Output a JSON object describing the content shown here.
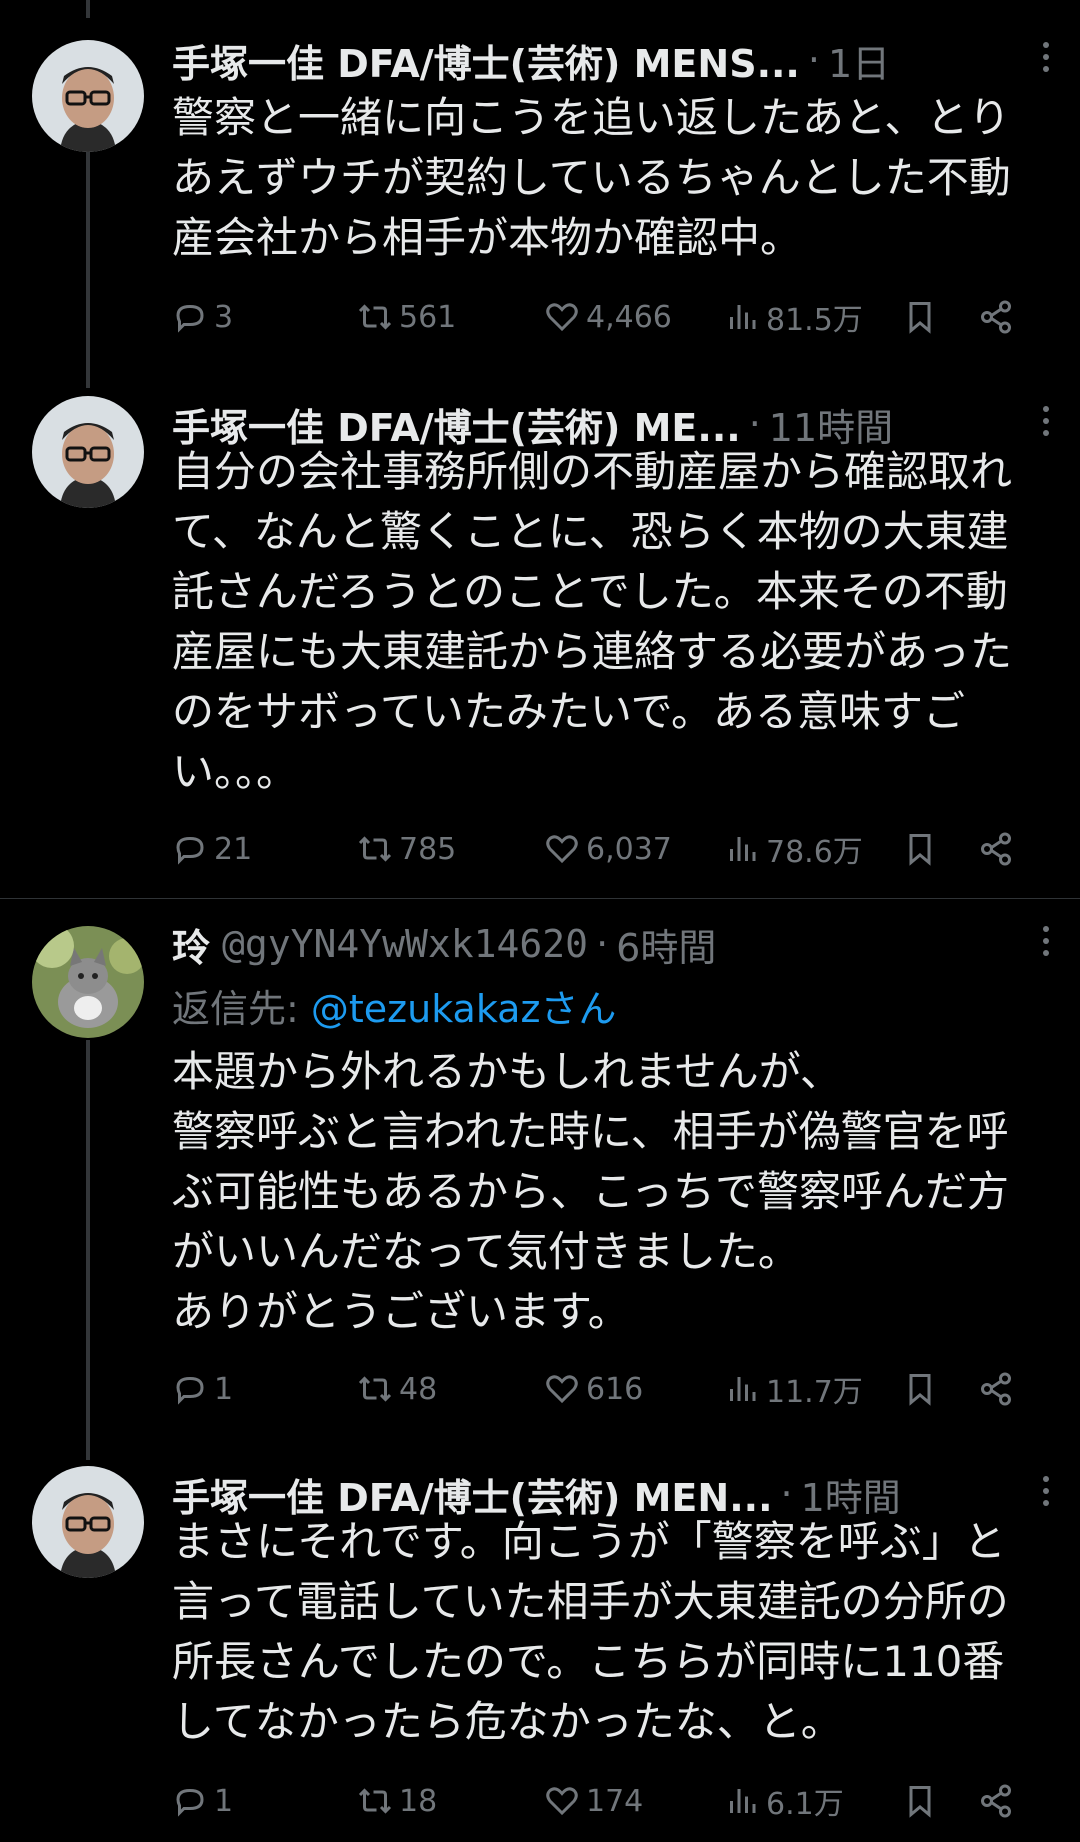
{
  "tweets": [
    {
      "name": "手塚一佳 DFA/博士(芸術) MENS...",
      "time": "1日",
      "text": "警察と一緒に向こうを追い返したあと、とりあえずウチが契約しているちゃんとした不動産会社から相手が本物か確認中。",
      "replies": "3",
      "retweets": "561",
      "likes": "4,466",
      "views": "81.5万"
    },
    {
      "name": "手塚一佳 DFA/博士(芸術) ME...",
      "time": "11時間",
      "text": "自分の会社事務所側の不動産屋から確認取れて、なんと驚くことに、恐らく本物の大東建託さんだろうとのことでした。本来その不動産屋にも大東建託から連絡する必要があったのをサボっていたみたいで。ある意味すごい。。。",
      "replies": "21",
      "retweets": "785",
      "likes": "6,037",
      "views": "78.6万"
    },
    {
      "name": "玲",
      "handle": "@gyYN4YwWxk14620",
      "time": "6時間",
      "reply_prefix": "返信先: ",
      "reply_mention": "@tezukakaz",
      "reply_suffix": "さん",
      "text": "本題から外れるかもしれませんが、\n警察呼ぶと言われた時に、相手が偽警官を呼ぶ可能性もあるから、こっちで警察呼んだ方がいいんだなって気付きました。\nありがとうございます。",
      "replies": "1",
      "retweets": "48",
      "likes": "616",
      "views": "11.7万"
    },
    {
      "name": "手塚一佳 DFA/博士(芸術) MEN...",
      "time": "1時間",
      "text": "まさにそれです。向こうが「警察を呼ぶ」と言って電話していた相手が大東建託の分所の所長さんでしたので。こちらが同時に110番してなかったら危なかったな、と。",
      "replies": "1",
      "retweets": "18",
      "likes": "174",
      "views": "6.1万"
    }
  ],
  "dot": "·",
  "icons": [
    "reply-icon",
    "retweet-icon",
    "like-icon",
    "views-icon",
    "bookmark-icon",
    "share-icon",
    "more-icon"
  ],
  "colors": {
    "background": "#000000",
    "text": "#e7e9ea",
    "muted": "#71767b",
    "link": "#1d9bf0"
  }
}
